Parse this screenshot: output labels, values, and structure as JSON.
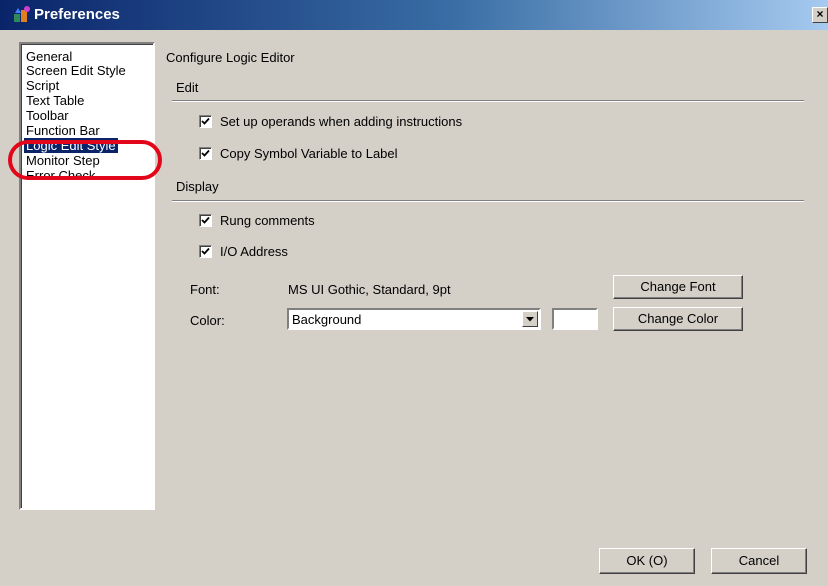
{
  "window": {
    "title": "Preferences",
    "close_glyph": "×"
  },
  "nav": {
    "items": [
      {
        "label": "General"
      },
      {
        "label": "Screen Edit Style"
      },
      {
        "label": "Script"
      },
      {
        "label": "Text Table"
      },
      {
        "label": "Toolbar"
      },
      {
        "label": "Function Bar"
      },
      {
        "label": "Logic Edit Style",
        "selected": true
      },
      {
        "label": "Monitor Step"
      },
      {
        "label": "Error Check"
      }
    ]
  },
  "main": {
    "heading": "Configure Logic Editor",
    "edit_section": {
      "title": "Edit",
      "options": [
        {
          "label": "Set up operands when adding instructions",
          "checked": true
        },
        {
          "label": "Copy Symbol Variable to Label",
          "checked": true
        }
      ]
    },
    "display_section": {
      "title": "Display",
      "options": [
        {
          "label": "Rung comments",
          "checked": true
        },
        {
          "label": "I/O Address",
          "checked": true
        }
      ],
      "font_label": "Font:",
      "font_value": "MS UI Gothic, Standard, 9pt",
      "change_font_label": "Change Font",
      "color_label": "Color:",
      "color_value": "Background",
      "change_color_label": "Change Color",
      "color_swatch": "#ffffff"
    }
  },
  "footer": {
    "ok_label": "OK (O)",
    "cancel_label": "Cancel"
  },
  "colors": {
    "highlight_annotation": "#e3061b",
    "selection": "#0a246a",
    "title_bar": "#0a246a"
  }
}
